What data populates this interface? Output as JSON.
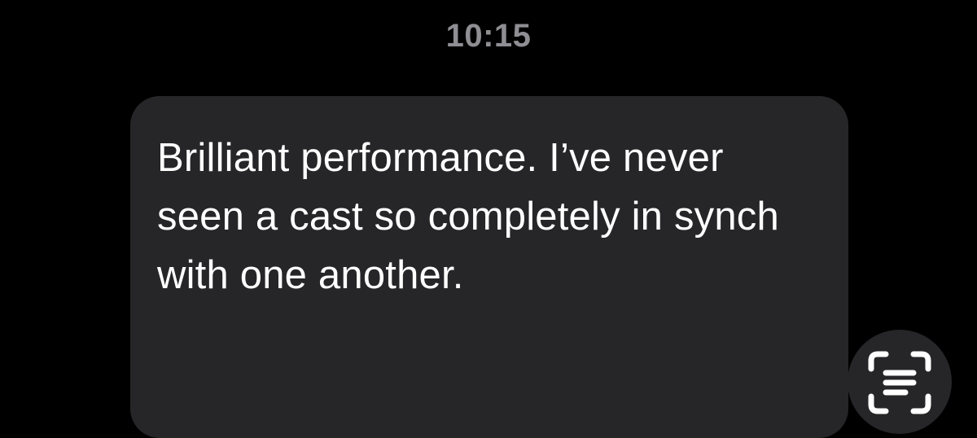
{
  "conversation": {
    "timestamp": "10:15",
    "message": {
      "text": "Brilliant performance. I’ve never seen a cast so completely in synch with one another."
    }
  },
  "controls": {
    "live_text_button": {
      "icon": "text-scan-icon"
    }
  }
}
